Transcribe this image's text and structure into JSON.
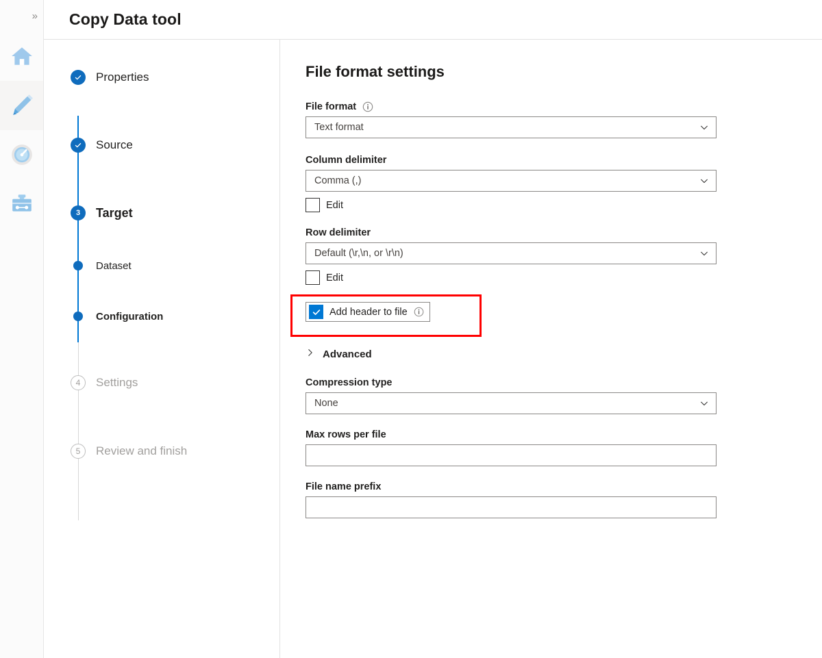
{
  "rail": {
    "expand_icon": "chevron-double-right-icon",
    "items": [
      {
        "icon": "home-icon",
        "name": "home",
        "selected": false
      },
      {
        "icon": "pencil-icon",
        "name": "author",
        "selected": true
      },
      {
        "icon": "gauge-icon",
        "name": "monitor",
        "selected": false
      },
      {
        "icon": "toolbox-icon",
        "name": "manage",
        "selected": false
      }
    ]
  },
  "header": {
    "title": "Copy Data tool"
  },
  "wizard": {
    "steps": [
      {
        "label": "Properties",
        "state": "done",
        "marker": "check"
      },
      {
        "label": "Source",
        "state": "done",
        "marker": "check"
      },
      {
        "label": "Target",
        "state": "current",
        "marker": "3"
      },
      {
        "label": "Dataset",
        "state": "sub",
        "marker": "dot"
      },
      {
        "label": "Configuration",
        "state": "sub-active",
        "marker": "dot"
      },
      {
        "label": "Settings",
        "state": "future",
        "marker": "4"
      },
      {
        "label": "Review and finish",
        "state": "future",
        "marker": "5"
      }
    ]
  },
  "form": {
    "heading": "File format settings",
    "file_format": {
      "label": "File format",
      "info_icon": "info-icon",
      "value": "Text format",
      "caret_icon": "chevron-down-icon"
    },
    "column_delimiter": {
      "label": "Column delimiter",
      "value": "Comma (,)",
      "caret_icon": "chevron-down-icon",
      "edit_label": "Edit",
      "edit_checked": false
    },
    "row_delimiter": {
      "label": "Row delimiter",
      "value": "Default (\\r,\\n, or \\r\\n)",
      "caret_icon": "chevron-down-icon",
      "edit_label": "Edit",
      "edit_checked": false
    },
    "add_header": {
      "label": "Add header to file",
      "checked": true,
      "info_icon": "info-icon",
      "highlight_color": "#ff0000"
    },
    "advanced": {
      "label": "Advanced",
      "chevron_icon": "chevron-right-icon",
      "expanded": false
    },
    "compression_type": {
      "label": "Compression type",
      "value": "None",
      "caret_icon": "chevron-down-icon"
    },
    "max_rows_per_file": {
      "label": "Max rows per file",
      "value": "",
      "placeholder": ""
    },
    "file_name_prefix": {
      "label": "File name prefix",
      "value": "",
      "placeholder": ""
    }
  },
  "colors": {
    "accent": "#0078d4",
    "step_blue": "#0f6cbd",
    "annotation_red": "#ff0000",
    "muted_text": "#a19f9d",
    "border": "#8a8886"
  }
}
